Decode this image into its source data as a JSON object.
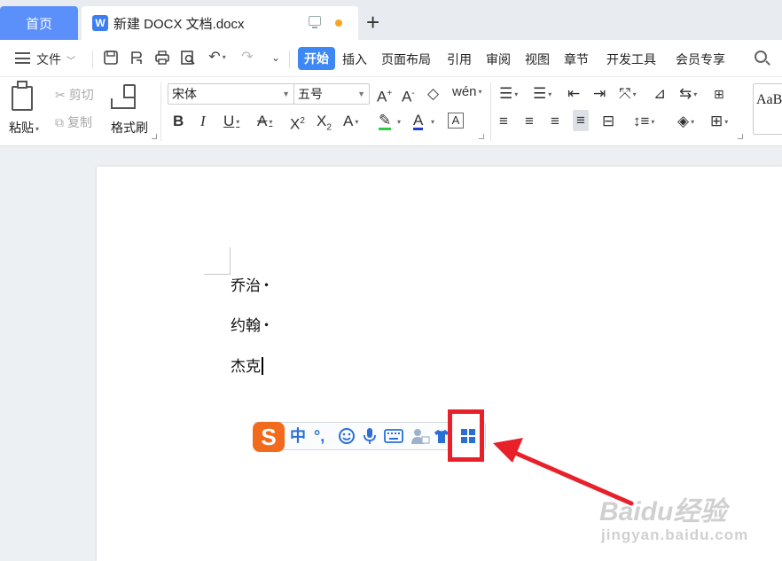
{
  "tabs": {
    "home_label": "首页",
    "doc_label": "新建 DOCX 文档.docx",
    "doc_icon": "W",
    "new_tab": "+"
  },
  "menu": {
    "file_label": "文件",
    "items": [
      "开始",
      "插入",
      "页面布局",
      "引用",
      "审阅",
      "视图",
      "章节",
      "开发工具",
      "会员专享"
    ],
    "active_index": 0
  },
  "ribbon": {
    "paste_label": "粘贴",
    "cut_label": "剪切",
    "copy_label": "复制",
    "format_painter_label": "格式刷",
    "font_name": "宋体",
    "font_size": "五号",
    "style_preview": "AaB"
  },
  "document": {
    "paragraphs": [
      "乔治",
      "约翰",
      "杰克"
    ],
    "paragraph_mark": "•"
  },
  "ime": {
    "logo": "S",
    "mode_label": "中",
    "punct_label": "°,"
  },
  "watermark": {
    "brand": "Baidu经验",
    "url": "jingyan.baidu.com"
  },
  "colors": {
    "accent": "#3d88f4",
    "home_tab": "#5b8ff9",
    "annotation_red": "#e8202a",
    "ime_orange": "#f26b1d"
  }
}
